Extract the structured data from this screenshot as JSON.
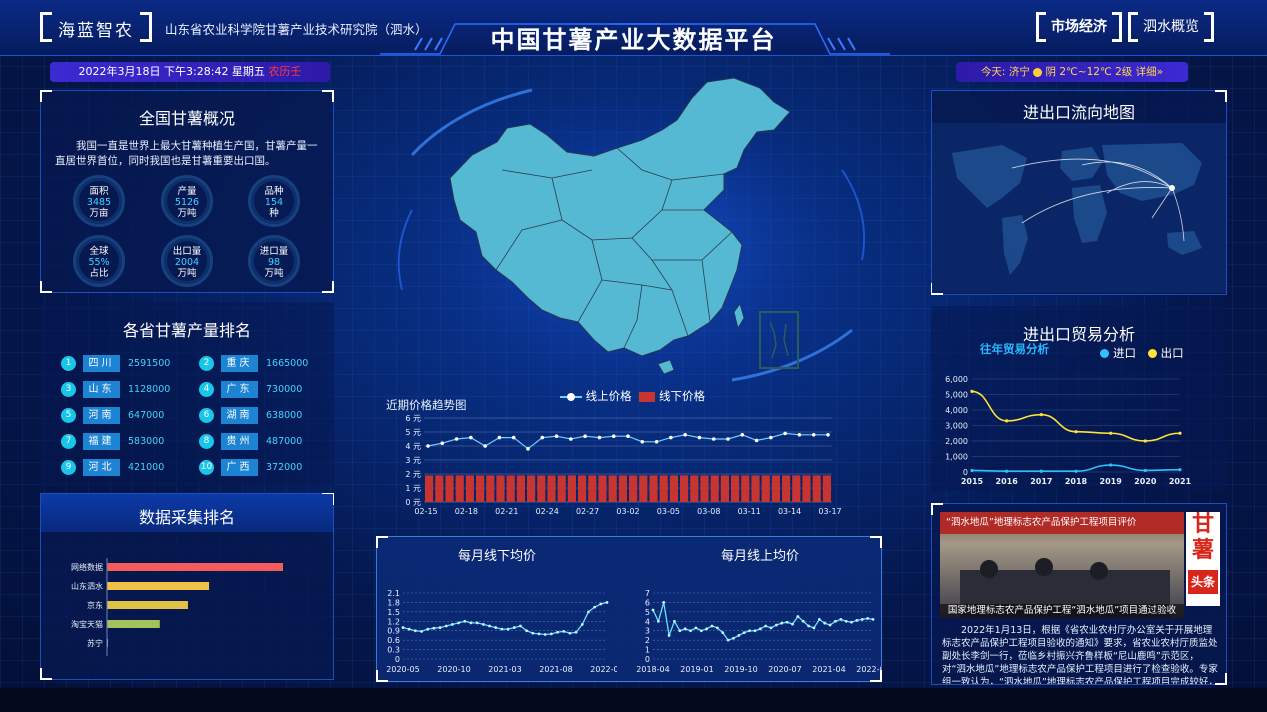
{
  "header": {
    "logo": "海蓝智农",
    "institute": "山东省农业科学院甘薯产业技术研究院（泗水）",
    "title": "中国甘薯产业大数据平台",
    "nav_market": "市场经济",
    "nav_sishui": "泗水概览"
  },
  "datebar": {
    "datetime": "2022年3月18日 下午3:28:42 星期五",
    "lunar": "农历壬"
  },
  "weather": {
    "text": "今天: 济宁 ☀ 阴 2℃~12℃ 2级 详细»",
    "pre": "今天: 济宁 ",
    "post": " 阴 2℃~12℃ 2级 详细»"
  },
  "overview": {
    "title": "全国甘薯概况",
    "desc": "我国一直是世界上最大甘薯种植生产国，甘薯产量一直居世界首位，同时我国也是甘薯重要出口国。",
    "stats": [
      {
        "label": "面积",
        "value": "3485",
        "unit": "万亩"
      },
      {
        "label": "产量",
        "value": "5126",
        "unit": "万吨"
      },
      {
        "label": "品种",
        "value": "154",
        "unit": "种"
      },
      {
        "label": "全球",
        "value": "55%",
        "unit": "占比"
      },
      {
        "label": "出口量",
        "value": "2004",
        "unit": "万吨"
      },
      {
        "label": "进口量",
        "value": "98",
        "unit": "万吨"
      }
    ]
  },
  "ranking": {
    "title": "各省甘薯产量排名",
    "items": [
      {
        "rank": "1",
        "prov": "四川",
        "value": "2591500"
      },
      {
        "rank": "2",
        "prov": "重庆",
        "value": "1665000"
      },
      {
        "rank": "3",
        "prov": "山东",
        "value": "1128000"
      },
      {
        "rank": "4",
        "prov": "广东",
        "value": "730000"
      },
      {
        "rank": "5",
        "prov": "河南",
        "value": "647000"
      },
      {
        "rank": "6",
        "prov": "湖南",
        "value": "638000"
      },
      {
        "rank": "7",
        "prov": "福建",
        "value": "583000"
      },
      {
        "rank": "8",
        "prov": "贵州",
        "value": "487000"
      },
      {
        "rank": "9",
        "prov": "河北",
        "value": "421000"
      },
      {
        "rank": "10",
        "prov": "广西",
        "value": "372000"
      }
    ]
  },
  "collection": {
    "title": "数据采集排名",
    "labels": [
      "网络数据",
      "山东泗水",
      "京东",
      "淘宝天猫",
      "苏宁"
    ],
    "values": [
      100,
      58,
      46,
      30,
      0.5
    ],
    "colors": [
      "#f45b5b",
      "#f2c045",
      "#e0c24a",
      "#a4c25a",
      "#7cb5ec"
    ]
  },
  "map_title": "近期价格趋势图",
  "chart_data": [
    {
      "type": "line",
      "title": "近期价格趋势图",
      "series": [
        {
          "name": "线上价格",
          "type": "line",
          "color": "#6ed1ff",
          "values": [
            4.0,
            4.2,
            4.5,
            4.6,
            4.0,
            4.6,
            4.6,
            3.8,
            4.6,
            4.7,
            4.5,
            4.7,
            4.6,
            4.7,
            4.7,
            4.3,
            4.3,
            4.6,
            4.8,
            4.6,
            4.5,
            4.5,
            4.8,
            4.4,
            4.6,
            4.9,
            4.8,
            4.8,
            4.8
          ]
        },
        {
          "name": "线下价格",
          "type": "bar",
          "color": "#c8342f",
          "values": [
            1.9,
            1.9,
            1.9,
            1.9,
            1.9,
            1.9,
            1.9,
            1.9,
            1.9,
            1.9,
            1.9,
            1.9,
            1.9,
            1.9,
            1.9,
            1.9,
            1.9,
            1.9,
            1.9,
            1.9,
            1.9,
            1.9,
            1.9,
            1.9,
            1.9,
            1.9,
            1.9,
            1.9,
            1.9,
            1.9,
            1.9,
            1.9,
            1.9,
            1.9,
            1.9,
            1.9,
            1.9,
            1.9,
            1.9,
            1.9
          ]
        }
      ],
      "xticks": [
        "02-15",
        "02-18",
        "02-21",
        "02-24",
        "02-27",
        "03-02",
        "03-05",
        "03-08",
        "03-11",
        "03-14",
        "03-17"
      ],
      "yticks": [
        "0 元",
        "1 元",
        "2 元",
        "3 元",
        "4 元",
        "5 元",
        "6 元"
      ],
      "ylim": [
        0,
        6
      ]
    },
    {
      "type": "line",
      "title": "每月线下均价",
      "series": [
        {
          "values": [
            1.0,
            0.95,
            0.9,
            0.88,
            0.95,
            0.98,
            1.0,
            1.05,
            1.1,
            1.15,
            1.2,
            1.15,
            1.15,
            1.1,
            1.05,
            1.0,
            0.95,
            0.95,
            1.0,
            1.05,
            0.9,
            0.82,
            0.8,
            0.78,
            0.8,
            0.85,
            0.88,
            0.82,
            0.85,
            1.1,
            1.5,
            1.65,
            1.75,
            1.8
          ]
        }
      ],
      "xticks": [
        "2020-05",
        "2020-10",
        "2021-03",
        "2021-08",
        "2022-01"
      ],
      "yticks": [
        "0",
        "0.3",
        "0.6",
        "0.9",
        "1.2",
        "1.5",
        "1.8",
        "2.1"
      ],
      "ylim": [
        0,
        2.1
      ],
      "color": "#69e3ff"
    },
    {
      "type": "line",
      "title": "每月线上均价",
      "series": [
        {
          "values": [
            5.2,
            4.0,
            6.0,
            2.5,
            4.0,
            3.0,
            3.2,
            3.0,
            3.3,
            3.0,
            3.2,
            3.5,
            3.3,
            2.8,
            2.0,
            2.2,
            2.5,
            2.8,
            3.0,
            3.0,
            3.2,
            3.5,
            3.3,
            3.6,
            3.8,
            3.9,
            3.7,
            4.5,
            4.0,
            3.5,
            3.3,
            4.2,
            3.8,
            3.6,
            4.0,
            4.2,
            4.0,
            3.9,
            4.1,
            4.2,
            4.3,
            4.2
          ]
        }
      ],
      "xticks": [
        "2018-04",
        "2019-01",
        "2019-10",
        "2020-07",
        "2021-04",
        "2022-01"
      ],
      "yticks": [
        "0",
        "1",
        "2",
        "3",
        "4",
        "5",
        "6",
        "7"
      ],
      "ylim": [
        0,
        7
      ],
      "color": "#69e3ff"
    },
    {
      "type": "line",
      "title": "进出口贸易分析",
      "subtitle": "往年贸易分析",
      "series": [
        {
          "name": "进口",
          "values": [
            100,
            50,
            50,
            50,
            450,
            100,
            150
          ],
          "color": "#2ec0ff"
        },
        {
          "name": "出口",
          "values": [
            5200,
            3300,
            3700,
            2600,
            2500,
            2000,
            2500
          ],
          "color": "#ffe23a"
        }
      ],
      "x": [
        "2015",
        "2016",
        "2017",
        "2018",
        "2019",
        "2020",
        "2021"
      ],
      "yticks": [
        "0",
        "1,000",
        "2,000",
        "3,000",
        "4,000",
        "5,000",
        "6,000"
      ],
      "ylim": [
        0,
        6000
      ]
    }
  ],
  "flowmap_title": "进出口流向地图",
  "news": {
    "caption": "国家地理标志农产品保护工程“泗水地瓜”项目通过验收",
    "badge_top": "甘",
    "badge_mid": "薯",
    "badge_bottom": "头条",
    "banner": "“泗水地瓜”地理标志农产品保护工程项目评价",
    "body": "2022年1月13日，根据《省农业农村厅办公室关于开展地理标志农产品保护工程项目验收的通知》要求，省农业农村厅质监处副处长李剑一行，莅临乡村振兴齐鲁样板“尼山鹿鸣”示范区，对“泗水地瓜”地理标志农产品保护工程项目进行了检查验收。专家组一致认为，“泗水地瓜”地理标志农产品保护工程项目完成较好，项目实施过程管..."
  }
}
